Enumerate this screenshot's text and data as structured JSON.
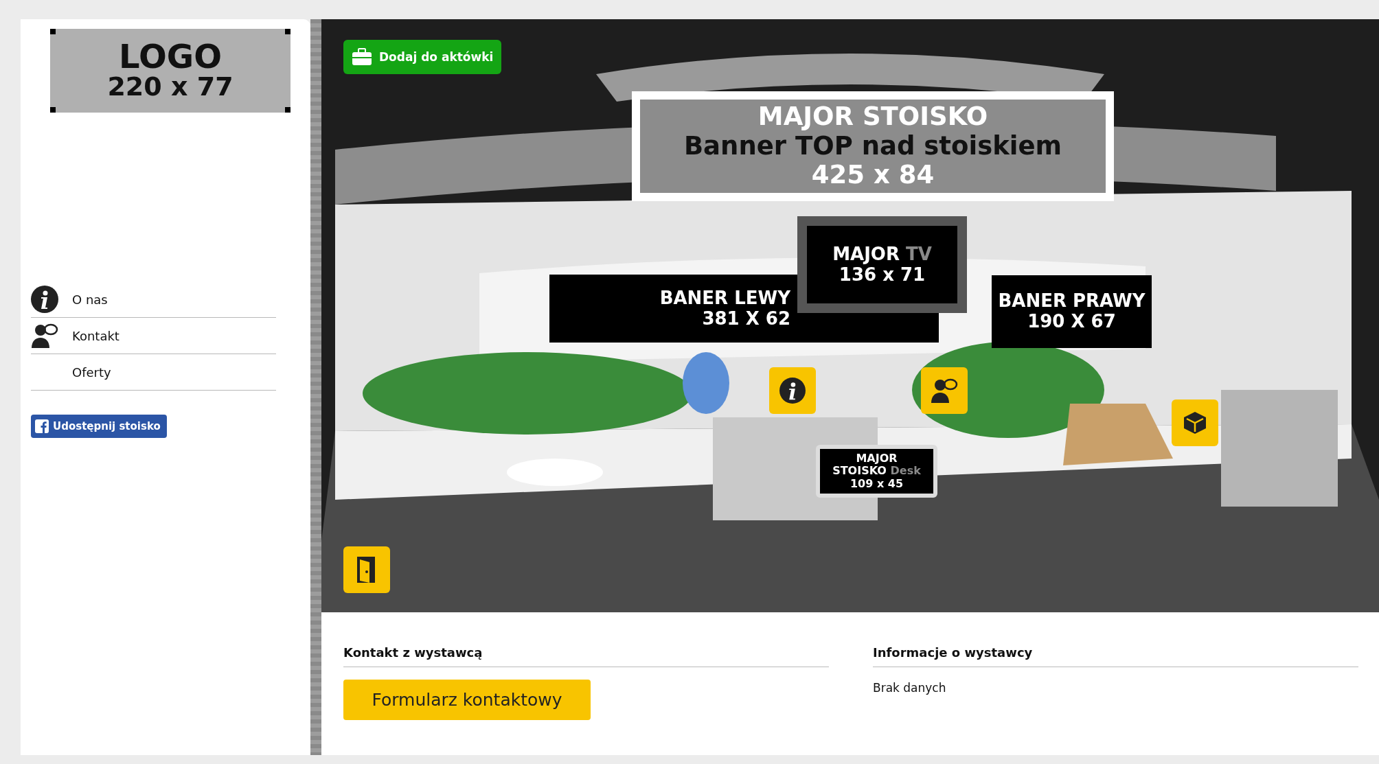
{
  "sidebar": {
    "logo": {
      "title": "LOGO",
      "size": "220 x 77"
    },
    "menu": [
      {
        "label": "O nas",
        "kind": "info"
      },
      {
        "label": "Kontakt",
        "kind": "contact"
      },
      {
        "label": "Oferty",
        "kind": "plain"
      }
    ],
    "share_button": "Udostępnij stoisko"
  },
  "booth": {
    "briefcase_button": "Dodaj do aktówki",
    "banners": [
      {
        "kind": "top",
        "lines": [
          [
            {
              "text": "MAJOR STOISKO",
              "kind": "light"
            }
          ],
          [
            {
              "text": "Banner TOP nad stoiskiem",
              "kind": "dark"
            }
          ],
          [
            {
              "text": "425 x 84",
              "kind": "light"
            }
          ]
        ]
      },
      {
        "kind": "left",
        "lines": [
          [
            {
              "text": "BANER LEWY",
              "kind": "light"
            }
          ],
          [
            {
              "text": "381 X 62",
              "kind": "light"
            }
          ]
        ]
      },
      {
        "kind": "tv",
        "lines": [
          [
            {
              "text": "MAJOR",
              "kind": "light"
            },
            {
              "text": "TV",
              "kind": "dim"
            }
          ],
          [
            {
              "text": "136 x 71",
              "kind": "light"
            }
          ]
        ]
      },
      {
        "kind": "right",
        "lines": [
          [
            {
              "text": "BANER PRAWY",
              "kind": "light"
            }
          ],
          [
            {
              "text": "190 X 67",
              "kind": "light"
            }
          ]
        ]
      },
      {
        "kind": "desk",
        "lines": [
          [
            {
              "text": "MAJOR",
              "kind": "light"
            }
          ],
          [
            {
              "text": "STOISKO",
              "kind": "light"
            },
            {
              "text": "Desk",
              "kind": "dim"
            }
          ],
          [
            {
              "text": "109 x 45",
              "kind": "light"
            }
          ]
        ]
      }
    ],
    "hotspots": [
      {
        "kind": "info"
      },
      {
        "kind": "contact"
      },
      {
        "kind": "products"
      },
      {
        "kind": "exit"
      }
    ]
  },
  "contact": {
    "heading": "Kontakt z wystawcą",
    "button": "Formularz kontaktowy"
  },
  "info": {
    "heading": "Informacje o wystawcy",
    "text": "Brak danych"
  }
}
